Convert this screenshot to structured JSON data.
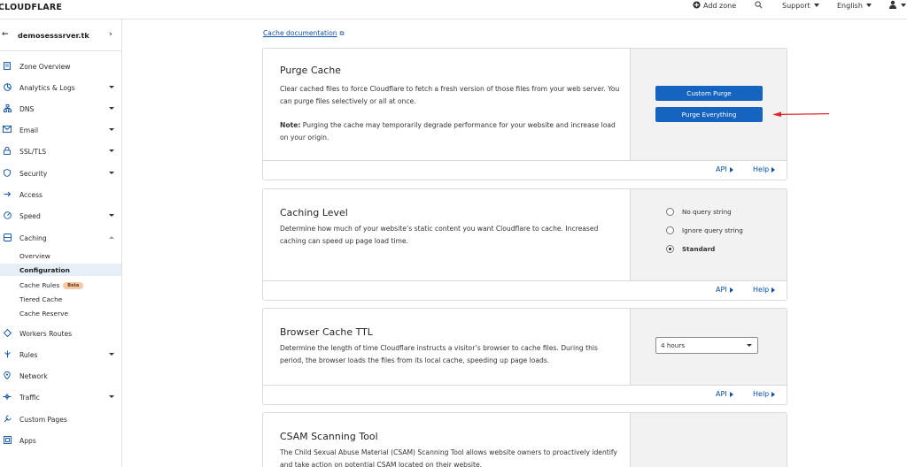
{
  "topbar": {
    "logo_text": "CLOUDFLARE",
    "add_zone": "Add zone",
    "support": "Support",
    "language": "English"
  },
  "sidebar": {
    "zone_name": "demosesssrver.tk",
    "items": [
      {
        "label": "Zone Overview",
        "icon": "document-icon"
      },
      {
        "label": "Analytics & Logs",
        "icon": "chart-icon",
        "has_caret": true
      },
      {
        "label": "DNS",
        "icon": "network-icon",
        "has_caret": true
      },
      {
        "label": "Email",
        "icon": "mail-icon",
        "has_caret": true
      },
      {
        "label": "SSL/TLS",
        "icon": "lock-icon",
        "has_caret": true
      },
      {
        "label": "Security",
        "icon": "shield-icon",
        "has_caret": true
      },
      {
        "label": "Access",
        "icon": "arrow-icon"
      },
      {
        "label": "Speed",
        "icon": "lightning-icon",
        "has_caret": true
      },
      {
        "label": "Caching",
        "icon": "caching-icon",
        "has_caret": true,
        "expanded": true
      }
    ],
    "caching_sub": [
      {
        "label": "Overview"
      },
      {
        "label": "Configuration",
        "active": true
      },
      {
        "label": "Cache Rules",
        "badge": "Beta"
      },
      {
        "label": "Tiered Cache"
      },
      {
        "label": "Cache Reserve"
      }
    ],
    "items_after": [
      {
        "label": "Workers Routes",
        "icon": "workers-icon"
      },
      {
        "label": "Rules",
        "icon": "rules-icon",
        "has_caret": true
      },
      {
        "label": "Network",
        "icon": "location-icon"
      },
      {
        "label": "Traffic",
        "icon": "traffic-icon",
        "has_caret": true
      },
      {
        "label": "Custom Pages",
        "icon": "wrench-icon"
      },
      {
        "label": "Apps",
        "icon": "apps-icon"
      }
    ]
  },
  "main": {
    "doc_link": "Cache documentation",
    "purge": {
      "title": "Purge Cache",
      "description": "Clear cached files to force Cloudflare to fetch a fresh version of those files from your web server. You can purge files selectively or all at once.",
      "note_label": "Note:",
      "note_text": " Purging the cache may temporarily degrade performance for your website and increase load on your origin.",
      "custom_purge": "Custom Purge",
      "purge_everything": "Purge Everything",
      "api": "API",
      "help": "Help"
    },
    "caching_level": {
      "title": "Caching Level",
      "description": "Determine how much of your website’s static content you want Cloudflare to cache. Increased caching can speed up page load time.",
      "options": [
        "No query string",
        "Ignore query string",
        "Standard"
      ],
      "selected": "Standard",
      "api": "API",
      "help": "Help"
    },
    "browser_ttl": {
      "title": "Browser Cache TTL",
      "description": "Determine the length of time Cloudflare instructs a visitor’s browser to cache files. During this period, the browser loads the files from its local cache, speeding up page loads.",
      "value": "4 hours",
      "api": "API",
      "help": "Help"
    },
    "csam": {
      "title": "CSAM Scanning Tool",
      "description": "The Child Sexual Abuse Material (CSAM) Scanning Tool allows website owners to proactively identify and take action on potential CSAM located on their website."
    }
  },
  "colors": {
    "accent": "#1565c0",
    "link": "#0b4fa8",
    "annotation_arrow": "#e0262b"
  }
}
